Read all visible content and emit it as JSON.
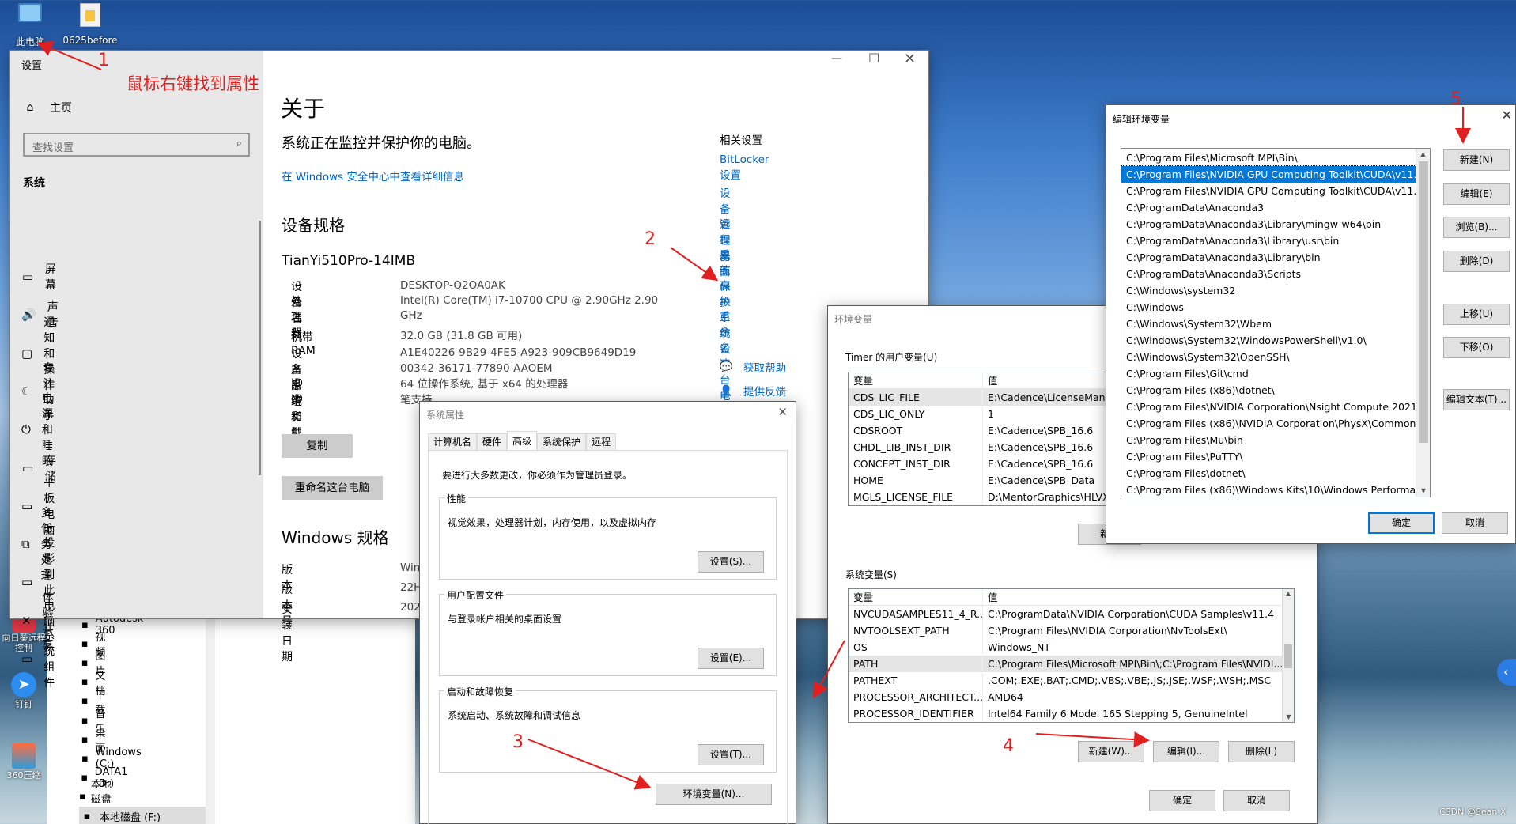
{
  "desktop": {
    "icons": [
      {
        "label": "此电脑",
        "icon": "computer-icon"
      },
      {
        "label": "0625before",
        "icon": "folder-icon"
      }
    ],
    "left_icons": [
      {
        "label": "向日葵远程控制",
        "icon": "sunflower-icon"
      },
      {
        "label": "钉钉",
        "icon": "dingtalk-icon"
      },
      {
        "label": "360压缩",
        "icon": "archive-icon"
      }
    ],
    "watermark": "CSDN @Sean X"
  },
  "annotations": {
    "a1_num": "1",
    "a1_text": "鼠标右键找到属性",
    "a2": "2",
    "a3": "3",
    "a4": "4",
    "a5": "5"
  },
  "explorer_tree": [
    {
      "label": "Autodesk 360",
      "icon": "autodesk-icon"
    },
    {
      "label": "视频",
      "icon": "video-icon"
    },
    {
      "label": "图片",
      "icon": "picture-icon"
    },
    {
      "label": "文档",
      "icon": "document-icon"
    },
    {
      "label": "下载",
      "icon": "download-icon"
    },
    {
      "label": "音乐",
      "icon": "music-icon"
    },
    {
      "label": "桌面",
      "icon": "desktop-icon"
    },
    {
      "label": "Windows (C:)",
      "icon": "drive-icon"
    },
    {
      "label": "DATA1 (D:)",
      "icon": "drive-icon"
    },
    {
      "label": "本地磁盘 (E:)",
      "icon": "drive-icon"
    },
    {
      "label": "本地磁盘 (F:)",
      "icon": "drive-icon"
    }
  ],
  "settings": {
    "window_title": "设置",
    "home": "主页",
    "search_placeholder": "查找设置",
    "section": "系统",
    "nav": [
      {
        "label": "屏幕",
        "icon": "monitor-icon"
      },
      {
        "label": "声音",
        "icon": "speaker-icon"
      },
      {
        "label": "通知和操作",
        "icon": "notification-icon"
      },
      {
        "label": "专注助手",
        "icon": "moon-icon"
      },
      {
        "label": "电源和睡眠",
        "icon": "power-icon"
      },
      {
        "label": "存储",
        "icon": "storage-icon"
      },
      {
        "label": "平板电脑",
        "icon": "tablet-icon"
      },
      {
        "label": "多任务处理",
        "icon": "multitask-icon"
      },
      {
        "label": "投影到此电脑",
        "icon": "project-icon"
      },
      {
        "label": "体验共享",
        "icon": "share-icon"
      },
      {
        "label": "系统组件",
        "icon": "components-icon"
      }
    ],
    "page_title": "关于",
    "protect_text": "系统正在监控并保护你的电脑。",
    "security_link": "在 Windows 安全中心中查看详细信息",
    "device_spec_heading": "设备规格",
    "device_model": "TianYi510Pro-14IMB",
    "specs": [
      {
        "k": "设备名称",
        "v": "DESKTOP-Q2OA0AK"
      },
      {
        "k": "处理器",
        "v": "Intel(R) Core(TM) i7-10700 CPU @ 2.90GHz   2.90 GHz"
      },
      {
        "k": "机带 RAM",
        "v": "32.0 GB (31.8 GB 可用)"
      },
      {
        "k": "设备 ID",
        "v": "A1E40226-9B29-4FE5-A923-909CB9649D19"
      },
      {
        "k": "产品 ID",
        "v": "00342-36171-77890-AAOEM"
      },
      {
        "k": "系统类型",
        "v": "64 位操作系统, 基于 x64 的处理器"
      },
      {
        "k": "笔和触控",
        "v": "笔支持"
      }
    ],
    "copy_button": "复制",
    "rename_button": "重命名这台电脑",
    "windows_spec_heading": "Windows 规格",
    "win_specs": [
      {
        "k": "版本",
        "v": "Windo"
      },
      {
        "k": "版本号",
        "v": "22H2"
      },
      {
        "k": "安装日期",
        "v": "2021/8"
      }
    ],
    "related_heading": "相关设置",
    "related_links": [
      "BitLocker 设置",
      "设备管理器",
      "远程桌面",
      "系统保护",
      "高级系统设置",
      "重命名这台电脑"
    ],
    "help": "获取帮助",
    "feedback": "提供反馈"
  },
  "sysprops": {
    "title": "系统属性",
    "tabs": [
      "计算机名",
      "硬件",
      "高级",
      "系统保护",
      "远程"
    ],
    "active_tab": "高级",
    "admin_note": "要进行大多数更改，你必须作为管理员登录。",
    "perf_title": "性能",
    "perf_desc": "视觉效果，处理器计划，内存使用，以及虚拟内存",
    "perf_btn": "设置(S)...",
    "profile_title": "用户配置文件",
    "profile_desc": "与登录帐户相关的桌面设置",
    "profile_btn": "设置(E)...",
    "startup_title": "启动和故障恢复",
    "startup_desc": "系统启动、系统故障和调试信息",
    "startup_btn": "设置(T)...",
    "envvar_btn": "环境变量(N)..."
  },
  "envvars": {
    "title": "环境变量",
    "user_label": "Timer 的用户变量(U)",
    "col_var": "变量",
    "col_val": "值",
    "user_vars": [
      {
        "k": "CDS_LIC_FILE",
        "v": "E:\\Cadence\\LicenseManager"
      },
      {
        "k": "CDS_LIC_ONLY",
        "v": "1"
      },
      {
        "k": "CDSROOT",
        "v": "E:\\Cadence\\SPB_16.6"
      },
      {
        "k": "CHDL_LIB_INST_DIR",
        "v": "E:\\Cadence\\SPB_16.6"
      },
      {
        "k": "CONCEPT_INST_DIR",
        "v": "E:\\Cadence\\SPB_16.6"
      },
      {
        "k": "HOME",
        "v": "E:\\Cadence\\SPB_Data"
      },
      {
        "k": "MGLS_LICENSE_FILE",
        "v": "D:\\MentorGraphics\\HLVX"
      }
    ],
    "user_new_btn": "新建",
    "sys_label": "系统变量(S)",
    "sys_vars": [
      {
        "k": "NVCUDASAMPLES11_4_R...",
        "v": "C:\\ProgramData\\NVIDIA Corporation\\CUDA Samples\\v11.4"
      },
      {
        "k": "NVTOOLSEXT_PATH",
        "v": "C:\\Program Files\\NVIDIA Corporation\\NvToolsExt\\"
      },
      {
        "k": "OS",
        "v": "Windows_NT"
      },
      {
        "k": "PATH",
        "v": "C:\\Program Files\\Microsoft MPI\\Bin\\;C:\\Program Files\\NVIDI..."
      },
      {
        "k": "PATHEXT",
        "v": ".COM;.EXE;.BAT;.CMD;.VBS;.VBE;.JS;.JSE;.WSF;.WSH;.MSC"
      },
      {
        "k": "PROCESSOR_ARCHITECT...",
        "v": "AMD64"
      },
      {
        "k": "PROCESSOR_IDENTIFIER",
        "v": "Intel64 Family 6 Model 165 Stepping 5, GenuineIntel"
      }
    ],
    "new_btn": "新建(W)...",
    "edit_btn": "编辑(I)...",
    "del_btn": "删除(L)",
    "ok_btn": "确定",
    "cancel_btn": "取消"
  },
  "editenv": {
    "title": "编辑环境变量",
    "paths": [
      "C:\\Program Files\\Microsoft MPI\\Bin\\",
      "C:\\Program Files\\NVIDIA GPU Computing Toolkit\\CUDA\\v11....",
      "C:\\Program Files\\NVIDIA GPU Computing Toolkit\\CUDA\\v11....",
      "C:\\ProgramData\\Anaconda3",
      "C:\\ProgramData\\Anaconda3\\Library\\mingw-w64\\bin",
      "C:\\ProgramData\\Anaconda3\\Library\\usr\\bin",
      "C:\\ProgramData\\Anaconda3\\Library\\bin",
      "C:\\ProgramData\\Anaconda3\\Scripts",
      "C:\\Windows\\system32",
      "C:\\Windows",
      "C:\\Windows\\System32\\Wbem",
      "C:\\Windows\\System32\\WindowsPowerShell\\v1.0\\",
      "C:\\Windows\\System32\\OpenSSH\\",
      "C:\\Program Files\\Git\\cmd",
      "C:\\Program Files (x86)\\dotnet\\",
      "C:\\Program Files\\NVIDIA Corporation\\Nsight Compute 2021....",
      "C:\\Program Files (x86)\\NVIDIA Corporation\\PhysX\\Common",
      "C:\\Program Files\\Mu\\bin",
      "C:\\Program Files\\PuTTY\\",
      "C:\\Program Files\\dotnet\\",
      "C:\\Program Files (x86)\\Windows Kits\\10\\Windows Performan..."
    ],
    "buttons": [
      "新建(N)",
      "编辑(E)",
      "浏览(B)...",
      "删除(D)",
      "上移(U)",
      "下移(O)",
      "编辑文本(T)..."
    ],
    "ok_btn": "确定",
    "cancel_btn": "取消"
  }
}
